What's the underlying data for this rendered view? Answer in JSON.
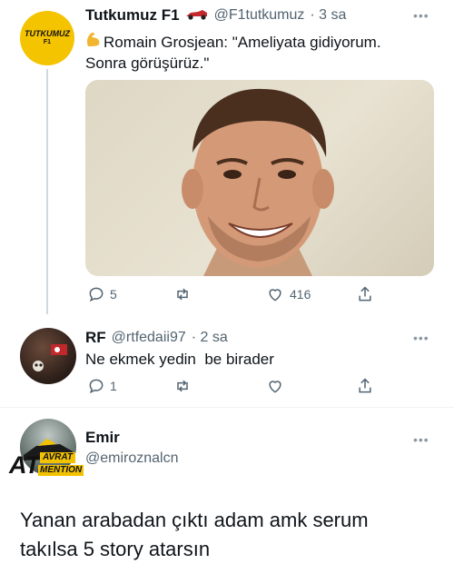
{
  "tweets": [
    {
      "name": "Tutkumuz F1",
      "handle": "@F1tutkumuz",
      "time": "· 3 sa",
      "text_line1": "Romain Grosjean: \"Ameliyata gidiyorum.",
      "text_line2": "Sonra görüşürüz.\"",
      "avatar_text": "TUTKUMUZ",
      "avatar_subtext": "F1",
      "replies": "5",
      "likes": "416"
    },
    {
      "name": "RF",
      "handle": "@rtfedaii97",
      "time": "· 2 sa",
      "text": "Ne ekmek yedin  be birader",
      "replies": "1"
    },
    {
      "name": "Emir",
      "handle": "@emiroznalcn",
      "avatar_text_big": "AT",
      "avatar_text_top": "AVRAT",
      "avatar_text_bottom": "MENTION"
    }
  ],
  "caption_line1": "Yanan arabadan çıktı adam amk serum",
  "caption_line2": "takılsa 5 story atarsın",
  "more_label": "•••",
  "colors": {
    "avatar1_bg": "#f5c400",
    "thread_line": "#cfd9de",
    "muted": "#536471"
  }
}
